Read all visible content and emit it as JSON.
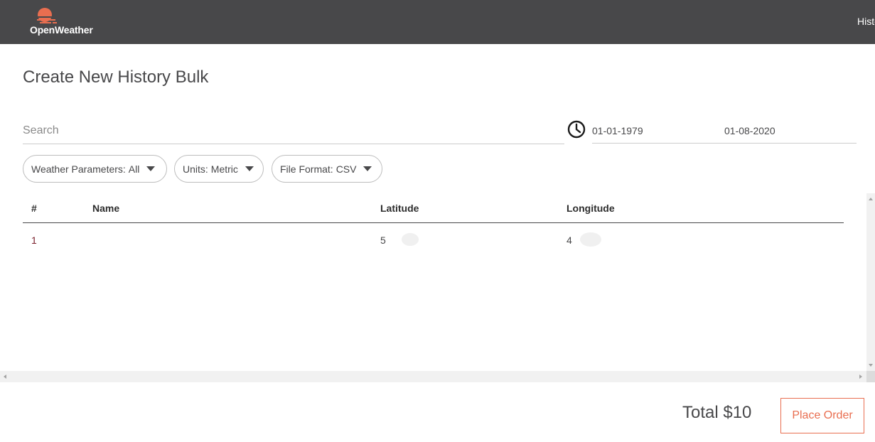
{
  "header": {
    "logo_text": "OpenWeather",
    "logo_icon": "sun-logo-icon",
    "nav_partial": "Histo",
    "brand_color": "#e96e50",
    "bar_color": "#48484a"
  },
  "page": {
    "title": "Create New History Bulk"
  },
  "search": {
    "placeholder": "Search",
    "value": ""
  },
  "date_range": {
    "icon": "clock-icon",
    "from": "01-01-1979",
    "to": "01-08-2020"
  },
  "filters": [
    {
      "label": "Weather Parameters:",
      "value": "All"
    },
    {
      "label": "Units:",
      "value": "Metric"
    },
    {
      "label": "File Format:",
      "value": "CSV"
    }
  ],
  "table": {
    "columns": [
      "#",
      "Name",
      "Latitude",
      "Longitude"
    ],
    "rows": [
      {
        "num": "1",
        "name": "",
        "latitude": "5",
        "longitude": "4"
      }
    ]
  },
  "footer": {
    "total": "Total $10",
    "order_button": "Place Order"
  }
}
